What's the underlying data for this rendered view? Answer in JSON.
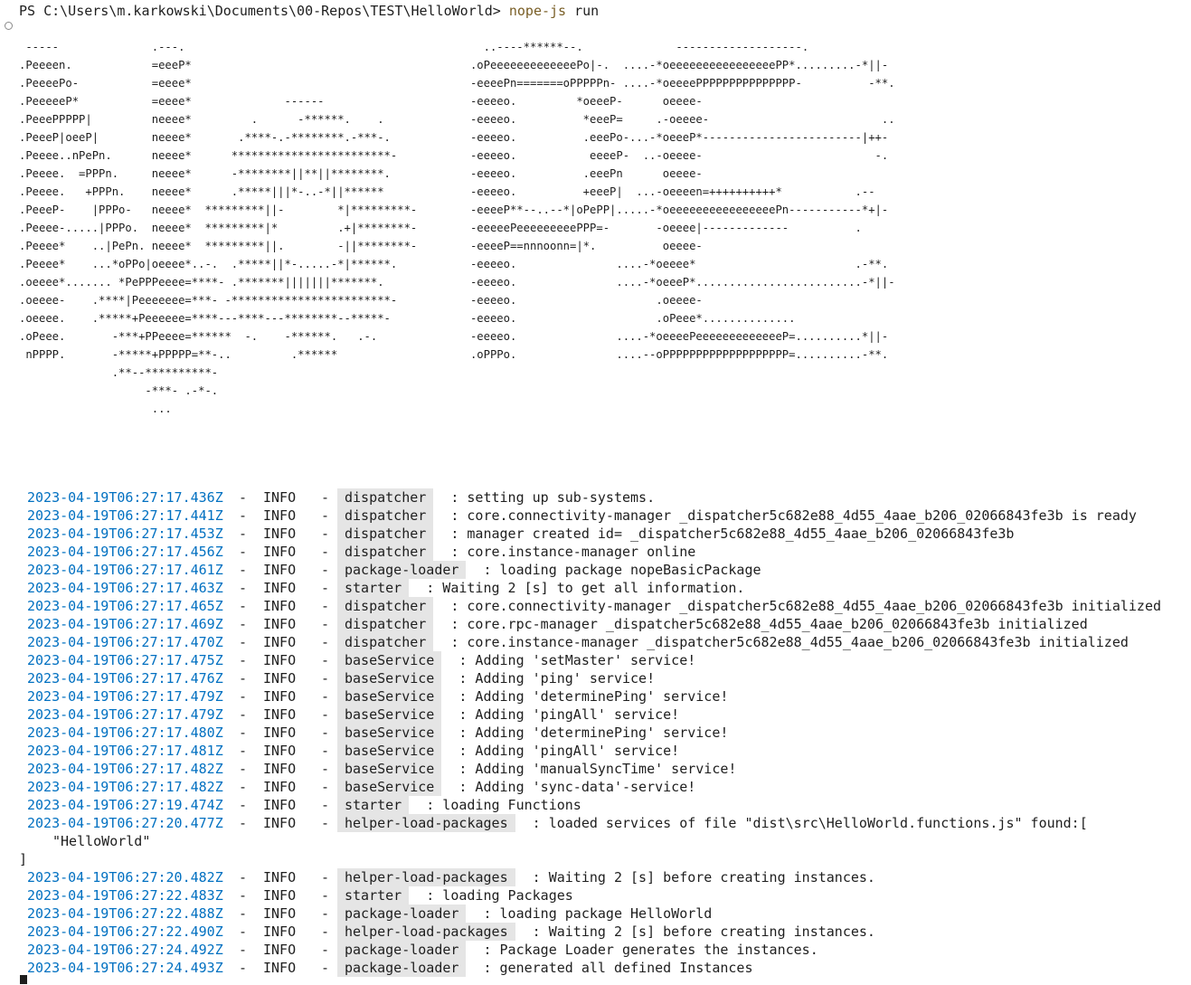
{
  "prompt": {
    "path": "PS C:\\Users\\m.karkowski\\Documents\\00-Repos\\TEST\\HelloWorld> ",
    "command": "nope-js",
    "args": " run"
  },
  "banner_art": " -----              .---.                                             ..----******--.              -------------------.\n.Peeeen.            =eeeP*                                          .oPeeeeeeeeeeeeePo|-.  ....-*oeeeeeeeeeeeeeeeePP*.........-*||-\n.PeeeePo-           =eeee*                                          -eeeePn=======oPPPPPn- ....-*oeeeePPPPPPPPPPPPPPP-          -**.\n.PeeeeeP*           =eeee*              ------                      -eeeeo.         *oeeeP-      oeeee-\n.PeeePPPPP|         neeee*         .      -******.    .             -eeeeo.          *eeeP=     .-oeeee-                          ..\n.PeeeP|oeeP|        neeee*       .****-.-********.-***-.            -eeeeo.          .eeePo-...-*oeeeP*------------------------|++-\n.Peeee..nPePn.      neeee*      ************************-           -eeeeo.           eeeeP-  ..-oeeee-                          -.\n.Peeee.  =PPPn.     neeee*      -********||**||********.            -eeeeo.          .eeePn      oeeee-\n.Peeee.   +PPPn.    neeee*      .*****|||*-..-*||******             -eeeeo.          +eeeP|  ...-oeeeen=++++++++++*           .--\n.PeeeP-    |PPPo-   neeee*  *********||-        *|*********-        -eeeeP**--..--*|oPePP|.....-*oeeeeeeeeeeeeeeeePn-----------*+|-\n.Peeee-.....|PPPo.  neeee*  *********|*         .+|********-        -eeeeePeeeeeeeeePPP=-       -oeeee|-------------          .\n.Peeee*    ..|PePn. neeee*  *********||.        -||********-        -eeeeP==nnnoonn=|*.          oeeee-\n.Peeee*    ...*oPPo|oeeee*..-.  .*****||*-.....-*|******.           -eeeeo.               ....-*oeeee*                        .-**.\n.oeeee*....... *PePPPeeee=****- .*******|||||||*******.             -eeeeo.               ....-*oeeeP*.........................-*||-\n.oeeee-    .****|Peeeeeee=***- -************************-           -eeeeo.                     .oeeee-\n.oeeee.    .*****+Peeeeee=****---****---********--*****-            -eeeeo.                     .oPeee*..............\n.oPeee.       -***+PPeeee=******  -.    -******.   .-.              -eeeeo.               ....-*oeeeePeeeeeeeeeeeeeP=..........*||-\n nPPPP.       -*****+PPPPP=**-..         .******                    .oPPPo.               ....--oPPPPPPPPPPPPPPPPPPP=..........-**.\n              .**--**********-\n                   -***- .-*-.\n                    ...",
  "log_entries": [
    {
      "timestamp": "2023-04-19T06:27:17.436Z",
      "level": "INFO",
      "tag": "dispatcher",
      "message": " : setting up sub-systems."
    },
    {
      "timestamp": "2023-04-19T06:27:17.441Z",
      "level": "INFO",
      "tag": "dispatcher",
      "message": " : core.connectivity-manager _dispatcher5c682e88_4d55_4aae_b206_02066843fe3b is ready"
    },
    {
      "timestamp": "2023-04-19T06:27:17.453Z",
      "level": "INFO",
      "tag": "dispatcher",
      "message": " : manager created id= _dispatcher5c682e88_4d55_4aae_b206_02066843fe3b"
    },
    {
      "timestamp": "2023-04-19T06:27:17.456Z",
      "level": "INFO",
      "tag": "dispatcher",
      "message": " : core.instance-manager online"
    },
    {
      "timestamp": "2023-04-19T06:27:17.461Z",
      "level": "INFO",
      "tag": "package-loader",
      "message": " : loading package nopeBasicPackage"
    },
    {
      "timestamp": "2023-04-19T06:27:17.463Z",
      "level": "INFO",
      "tag": "starter",
      "message": " : Waiting 2 [s] to get all information."
    },
    {
      "timestamp": "2023-04-19T06:27:17.465Z",
      "level": "INFO",
      "tag": "dispatcher",
      "message": " : core.connectivity-manager _dispatcher5c682e88_4d55_4aae_b206_02066843fe3b initialized"
    },
    {
      "timestamp": "2023-04-19T06:27:17.469Z",
      "level": "INFO",
      "tag": "dispatcher",
      "message": " : core.rpc-manager _dispatcher5c682e88_4d55_4aae_b206_02066843fe3b initialized"
    },
    {
      "timestamp": "2023-04-19T06:27:17.470Z",
      "level": "INFO",
      "tag": "dispatcher",
      "message": " : core.instance-manager _dispatcher5c682e88_4d55_4aae_b206_02066843fe3b initialized"
    },
    {
      "timestamp": "2023-04-19T06:27:17.475Z",
      "level": "INFO",
      "tag": "baseService",
      "message": " : Adding 'setMaster' service!"
    },
    {
      "timestamp": "2023-04-19T06:27:17.476Z",
      "level": "INFO",
      "tag": "baseService",
      "message": " : Adding 'ping' service!"
    },
    {
      "timestamp": "2023-04-19T06:27:17.479Z",
      "level": "INFO",
      "tag": "baseService",
      "message": " : Adding 'determinePing' service!"
    },
    {
      "timestamp": "2023-04-19T06:27:17.479Z",
      "level": "INFO",
      "tag": "baseService",
      "message": " : Adding 'pingAll' service!"
    },
    {
      "timestamp": "2023-04-19T06:27:17.480Z",
      "level": "INFO",
      "tag": "baseService",
      "message": " : Adding 'determinePing' service!"
    },
    {
      "timestamp": "2023-04-19T06:27:17.481Z",
      "level": "INFO",
      "tag": "baseService",
      "message": " : Adding 'pingAll' service!"
    },
    {
      "timestamp": "2023-04-19T06:27:17.482Z",
      "level": "INFO",
      "tag": "baseService",
      "message": " : Adding 'manualSyncTime' service!"
    },
    {
      "timestamp": "2023-04-19T06:27:17.482Z",
      "level": "INFO",
      "tag": "baseService",
      "message": " : Adding 'sync-data'-service!"
    },
    {
      "timestamp": "2023-04-19T06:27:19.474Z",
      "level": "INFO",
      "tag": "starter",
      "message": " : loading Functions"
    },
    {
      "timestamp": "2023-04-19T06:27:20.477Z",
      "level": "INFO",
      "tag": "helper-load-packages",
      "message": " : loaded services of file \"dist\\src\\HelloWorld.functions.js\" found:[",
      "continuation": "\"HelloWorld\"",
      "closing": "]"
    },
    {
      "timestamp": "2023-04-19T06:27:20.482Z",
      "level": "INFO",
      "tag": "helper-load-packages",
      "message": " : Waiting 2 [s] before creating instances."
    },
    {
      "timestamp": "2023-04-19T06:27:22.483Z",
      "level": "INFO",
      "tag": "starter",
      "message": " : loading Packages"
    },
    {
      "timestamp": "2023-04-19T06:27:22.488Z",
      "level": "INFO",
      "tag": "package-loader",
      "message": " : loading package HelloWorld"
    },
    {
      "timestamp": "2023-04-19T06:27:22.490Z",
      "level": "INFO",
      "tag": "helper-load-packages",
      "message": " : Waiting 2 [s] before creating instances."
    },
    {
      "timestamp": "2023-04-19T06:27:24.492Z",
      "level": "INFO",
      "tag": "package-loader",
      "message": " : Package Loader generates the instances."
    },
    {
      "timestamp": "2023-04-19T06:27:24.493Z",
      "level": "INFO",
      "tag": "package-loader",
      "message": " : generated all defined Instances"
    }
  ],
  "separator": "-",
  "colors": {
    "timestamp": "#0070c1",
    "command": "#795e26",
    "tag_background": "#e5e5e5",
    "text": "#1e1e1e"
  }
}
